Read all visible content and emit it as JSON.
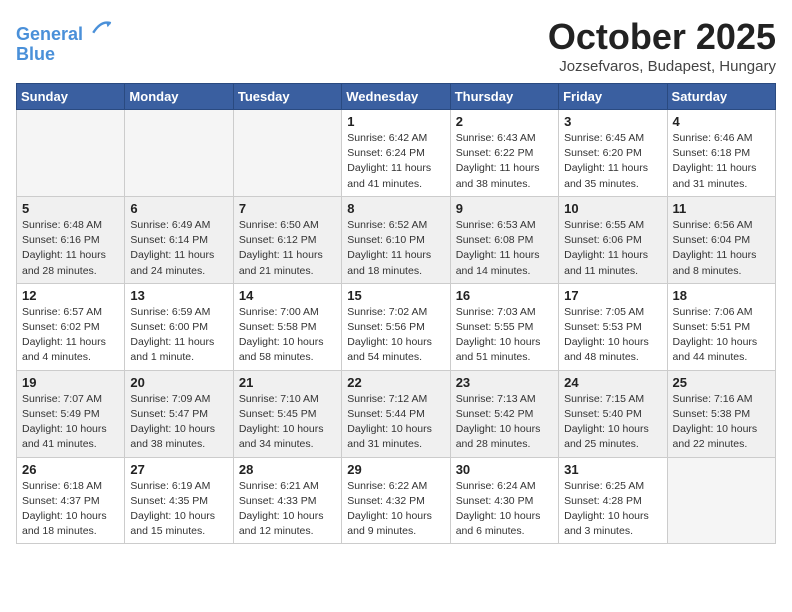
{
  "header": {
    "logo_line1": "General",
    "logo_line2": "Blue",
    "month": "October 2025",
    "location": "Jozsefvaros, Budapest, Hungary"
  },
  "days_of_week": [
    "Sunday",
    "Monday",
    "Tuesday",
    "Wednesday",
    "Thursday",
    "Friday",
    "Saturday"
  ],
  "weeks": [
    [
      {
        "day": "",
        "info": ""
      },
      {
        "day": "",
        "info": ""
      },
      {
        "day": "",
        "info": ""
      },
      {
        "day": "1",
        "info": "Sunrise: 6:42 AM\nSunset: 6:24 PM\nDaylight: 11 hours and 41 minutes."
      },
      {
        "day": "2",
        "info": "Sunrise: 6:43 AM\nSunset: 6:22 PM\nDaylight: 11 hours and 38 minutes."
      },
      {
        "day": "3",
        "info": "Sunrise: 6:45 AM\nSunset: 6:20 PM\nDaylight: 11 hours and 35 minutes."
      },
      {
        "day": "4",
        "info": "Sunrise: 6:46 AM\nSunset: 6:18 PM\nDaylight: 11 hours and 31 minutes."
      }
    ],
    [
      {
        "day": "5",
        "info": "Sunrise: 6:48 AM\nSunset: 6:16 PM\nDaylight: 11 hours and 28 minutes."
      },
      {
        "day": "6",
        "info": "Sunrise: 6:49 AM\nSunset: 6:14 PM\nDaylight: 11 hours and 24 minutes."
      },
      {
        "day": "7",
        "info": "Sunrise: 6:50 AM\nSunset: 6:12 PM\nDaylight: 11 hours and 21 minutes."
      },
      {
        "day": "8",
        "info": "Sunrise: 6:52 AM\nSunset: 6:10 PM\nDaylight: 11 hours and 18 minutes."
      },
      {
        "day": "9",
        "info": "Sunrise: 6:53 AM\nSunset: 6:08 PM\nDaylight: 11 hours and 14 minutes."
      },
      {
        "day": "10",
        "info": "Sunrise: 6:55 AM\nSunset: 6:06 PM\nDaylight: 11 hours and 11 minutes."
      },
      {
        "day": "11",
        "info": "Sunrise: 6:56 AM\nSunset: 6:04 PM\nDaylight: 11 hours and 8 minutes."
      }
    ],
    [
      {
        "day": "12",
        "info": "Sunrise: 6:57 AM\nSunset: 6:02 PM\nDaylight: 11 hours and 4 minutes."
      },
      {
        "day": "13",
        "info": "Sunrise: 6:59 AM\nSunset: 6:00 PM\nDaylight: 11 hours and 1 minute."
      },
      {
        "day": "14",
        "info": "Sunrise: 7:00 AM\nSunset: 5:58 PM\nDaylight: 10 hours and 58 minutes."
      },
      {
        "day": "15",
        "info": "Sunrise: 7:02 AM\nSunset: 5:56 PM\nDaylight: 10 hours and 54 minutes."
      },
      {
        "day": "16",
        "info": "Sunrise: 7:03 AM\nSunset: 5:55 PM\nDaylight: 10 hours and 51 minutes."
      },
      {
        "day": "17",
        "info": "Sunrise: 7:05 AM\nSunset: 5:53 PM\nDaylight: 10 hours and 48 minutes."
      },
      {
        "day": "18",
        "info": "Sunrise: 7:06 AM\nSunset: 5:51 PM\nDaylight: 10 hours and 44 minutes."
      }
    ],
    [
      {
        "day": "19",
        "info": "Sunrise: 7:07 AM\nSunset: 5:49 PM\nDaylight: 10 hours and 41 minutes."
      },
      {
        "day": "20",
        "info": "Sunrise: 7:09 AM\nSunset: 5:47 PM\nDaylight: 10 hours and 38 minutes."
      },
      {
        "day": "21",
        "info": "Sunrise: 7:10 AM\nSunset: 5:45 PM\nDaylight: 10 hours and 34 minutes."
      },
      {
        "day": "22",
        "info": "Sunrise: 7:12 AM\nSunset: 5:44 PM\nDaylight: 10 hours and 31 minutes."
      },
      {
        "day": "23",
        "info": "Sunrise: 7:13 AM\nSunset: 5:42 PM\nDaylight: 10 hours and 28 minutes."
      },
      {
        "day": "24",
        "info": "Sunrise: 7:15 AM\nSunset: 5:40 PM\nDaylight: 10 hours and 25 minutes."
      },
      {
        "day": "25",
        "info": "Sunrise: 7:16 AM\nSunset: 5:38 PM\nDaylight: 10 hours and 22 minutes."
      }
    ],
    [
      {
        "day": "26",
        "info": "Sunrise: 6:18 AM\nSunset: 4:37 PM\nDaylight: 10 hours and 18 minutes."
      },
      {
        "day": "27",
        "info": "Sunrise: 6:19 AM\nSunset: 4:35 PM\nDaylight: 10 hours and 15 minutes."
      },
      {
        "day": "28",
        "info": "Sunrise: 6:21 AM\nSunset: 4:33 PM\nDaylight: 10 hours and 12 minutes."
      },
      {
        "day": "29",
        "info": "Sunrise: 6:22 AM\nSunset: 4:32 PM\nDaylight: 10 hours and 9 minutes."
      },
      {
        "day": "30",
        "info": "Sunrise: 6:24 AM\nSunset: 4:30 PM\nDaylight: 10 hours and 6 minutes."
      },
      {
        "day": "31",
        "info": "Sunrise: 6:25 AM\nSunset: 4:28 PM\nDaylight: 10 hours and 3 minutes."
      },
      {
        "day": "",
        "info": ""
      }
    ]
  ]
}
